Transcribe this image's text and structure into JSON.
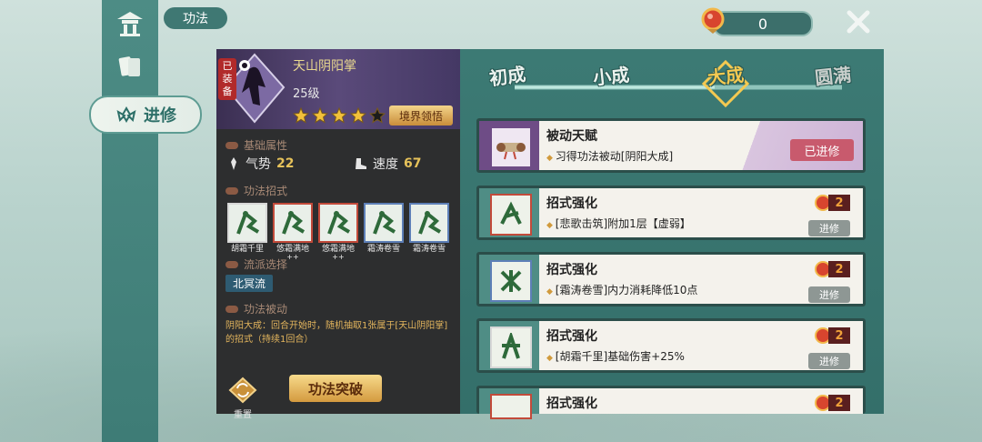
{
  "header": {
    "title": "功法",
    "coin_count": "0",
    "side_tab_label": "进修"
  },
  "skill": {
    "name": "天山阴阳掌",
    "level": "25级",
    "equipped_label": "已装备",
    "stars_filled": 4,
    "stars_total": 5,
    "realm_button": "境界领悟"
  },
  "sections": {
    "base_attr": "基础属性",
    "moves": "功法招式",
    "school": "流派选择",
    "passive": "功法被动"
  },
  "attributes": [
    {
      "label": "气势",
      "value": "22"
    },
    {
      "label": "速度",
      "value": "67"
    }
  ],
  "moves": [
    {
      "label": "胡霜千里",
      "plus": "",
      "frame": "white"
    },
    {
      "label": "悠霜满地",
      "plus": "++",
      "frame": "red"
    },
    {
      "label": "悠霜满地",
      "plus": "++",
      "frame": "red"
    },
    {
      "label": "霜涛卷雪",
      "plus": "",
      "frame": "blue"
    },
    {
      "label": "霜涛卷雪",
      "plus": "",
      "frame": "blue"
    }
  ],
  "school_tag": "北冥流",
  "passive_desc": "阴阳大成：回合开始时，随机抽取1张属于[天山阴阳掌]的招式（持续1回合）",
  "buttons": {
    "reset": "重置",
    "breakthrough": "功法突破"
  },
  "stages": [
    "初成",
    "小成",
    "大成",
    "圆满"
  ],
  "active_stage": "大成",
  "cards": [
    {
      "title": "被动天赋",
      "desc": "习得功法被动[阴阳大成]",
      "status": "已进修",
      "cost": "",
      "type": "passive"
    },
    {
      "title": "招式强化",
      "desc": "[悲歌击筑]附加1层【虚弱】",
      "status": "进修",
      "cost": "2",
      "type": "move"
    },
    {
      "title": "招式强化",
      "desc": "[霜涛卷雪]内力消耗降低10点",
      "status": "进修",
      "cost": "2",
      "type": "move"
    },
    {
      "title": "招式强化",
      "desc": "[胡霜千里]基础伤害+25%",
      "status": "进修",
      "cost": "2",
      "type": "move"
    },
    {
      "title": "招式强化",
      "desc": "",
      "status": "",
      "cost": "2",
      "type": "move"
    }
  ],
  "colors": {
    "accent_gold": "#f4c951",
    "panel_teal": "#3c7a74",
    "dark_panel": "#2d2e2f"
  }
}
